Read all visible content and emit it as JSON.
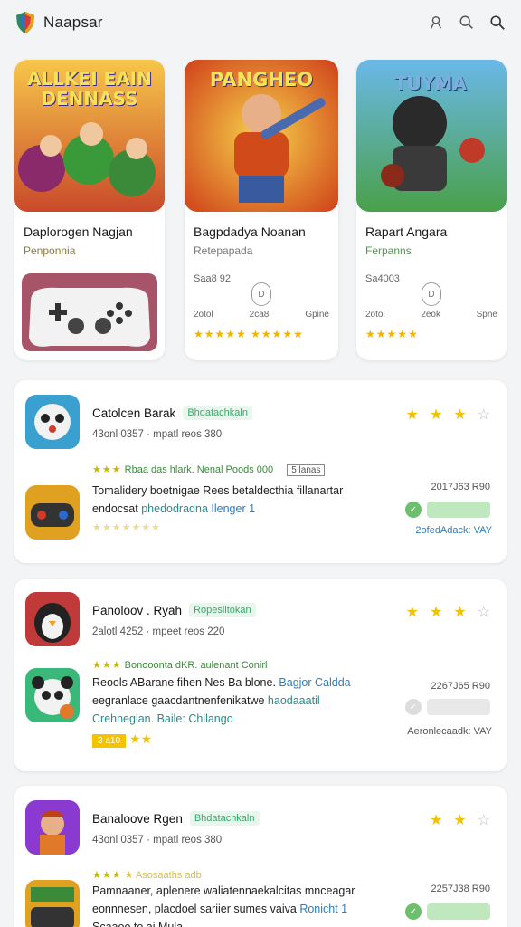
{
  "header": {
    "title": "Naapsar",
    "icons": [
      "shield-logo-icon",
      "user-icon",
      "search-icon",
      "search-icon-alt"
    ]
  },
  "featured": [
    {
      "art_text": "ALLKEI EAIN DENNASS",
      "title": "Daplorogen Nagjan",
      "subtitle": "Penponnia"
    },
    {
      "art_text": "PANGHEO",
      "title": "Bagpdadya Noanan",
      "subtitle": "Retepapada",
      "size": "Saa8 92",
      "pill": "D",
      "stats": [
        "2otol",
        "2ca8",
        "Gpine"
      ],
      "stars": "★★★★★ ★★★★★"
    },
    {
      "art_text": "TUYMA",
      "title": "Rapart Angara",
      "subtitle": "Ferpanns",
      "size": "Sa4003",
      "pill": "D",
      "stats": [
        "2otol",
        "2eok",
        "Spne"
      ],
      "stars": "★★★★★"
    }
  ],
  "list": [
    {
      "name": "Catolcen Barak",
      "tag": "Bhdatachkaln",
      "meta": "43onl 0357 · mpatl reos 380",
      "rating_line": {
        "stars": "★★★",
        "text": "Rbaa das hlark.  Nenal Poods 000",
        "box": "5 lanas"
      },
      "desc_a": "Tomalidery boetnigae Rees betaldecthia fillanartar",
      "desc_b": "endocsat",
      "desc_c": "phedodradna",
      "desc_d": "Ilenger 1",
      "small_stars": "★★★★★★★",
      "date": "2017J63 R90",
      "footer": "2ofedAdack: VAY"
    },
    {
      "name": "Panoloov . Ryah",
      "tag": "Ropesiltokan",
      "meta": "2alotl 4252 · mpeet reos 220",
      "rating_line": {
        "stars": "★★★",
        "text": "Bonooonta dKR.   aulenant Conirl",
        "box": ""
      },
      "desc_a": "Reools ABarane fihen Nes Ba blone.",
      "desc_a2": "Bagjor Caldda",
      "desc_b": "eegranlace gaacdantnenfenikatwe",
      "desc_b2": "haodaaatil",
      "desc_c": "Crehneglan. Baile: Chilango",
      "badge": "3 a10",
      "date": "2267J65 R90",
      "footer": "Aeronlecaadk: VAY"
    },
    {
      "name": "Banaloove Rgen",
      "tag": "Bhdatachkaln",
      "meta": "43onl 0357 · mpatl reos 380",
      "rating_line": {
        "stars": "★★★",
        "text": "★ Asosaaths adb",
        "box": ""
      },
      "desc_a": "Pamnaaner, aplenere waliatennaekalcitas mnceagar",
      "desc_b": "eonnnesen, placdoel sariier sumes vaiva",
      "desc_b2": "Ronicht 1",
      "desc_c": "Scaaoo to.ai  Mula",
      "date": "2257J38 R90"
    }
  ],
  "colors": {
    "star": "#f2c200",
    "accent_green": "#3aa86a",
    "link_blue": "#2d7dc0",
    "background": "#f3f4f6"
  }
}
